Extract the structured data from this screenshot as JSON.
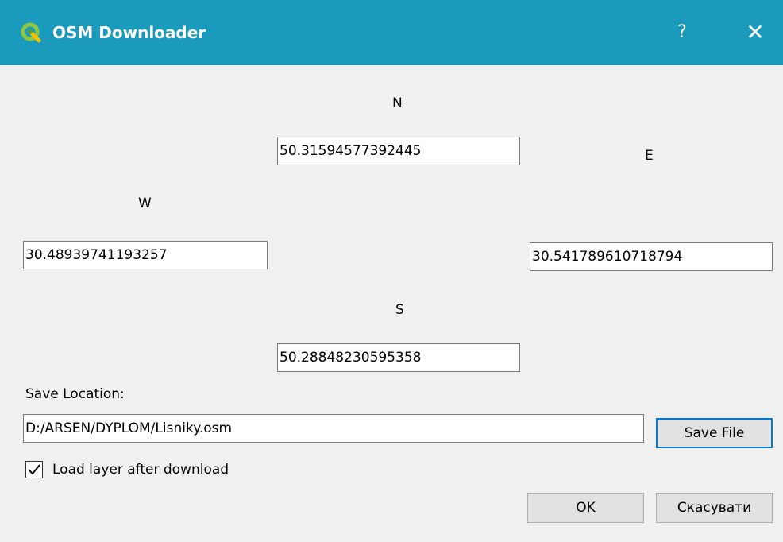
{
  "window": {
    "title": "OSM Downloader",
    "help_label": "?",
    "close_label": "✕",
    "accent_color": "#1a9bbd"
  },
  "bounds": {
    "north": {
      "label": "N",
      "value": "50.31594577392445"
    },
    "east": {
      "label": "E",
      "value": "30.541789610718794"
    },
    "west": {
      "label": "W",
      "value": "30.48939741193257"
    },
    "south": {
      "label": "S",
      "value": "50.28848230595358"
    }
  },
  "save": {
    "label": "Save Location:",
    "path": "D:/ARSEN/DYPLOM/Lisniky.osm",
    "button_label": "Save File"
  },
  "load_layer": {
    "label": "Load layer after download",
    "checked": true
  },
  "footer": {
    "ok_label": "OK",
    "cancel_label": "Скасувати"
  },
  "icons": [
    "qgis-logo-icon",
    "help-icon",
    "close-icon",
    "check-icon"
  ]
}
